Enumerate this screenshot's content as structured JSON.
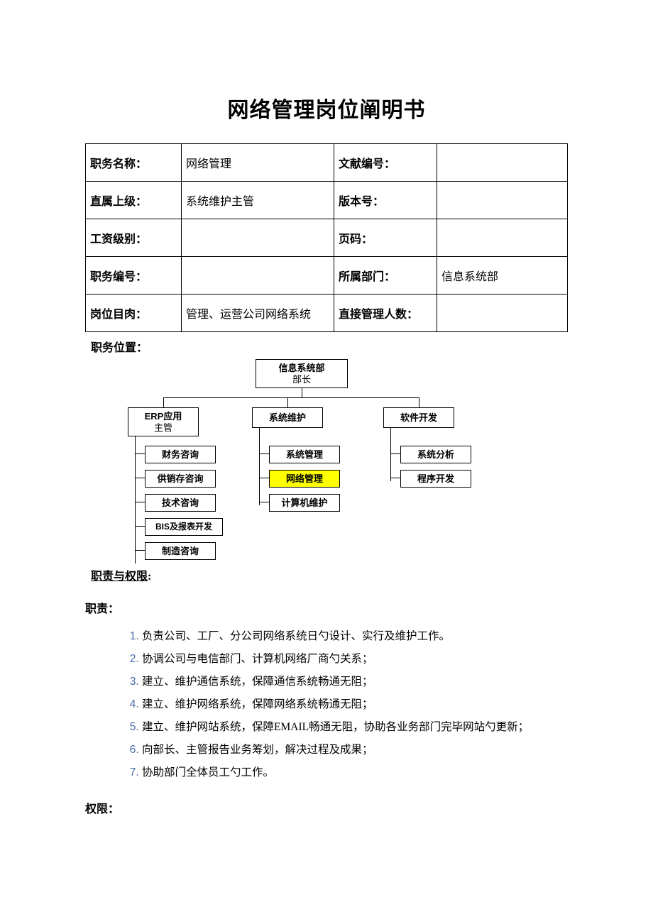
{
  "title": "网络管理岗位阐明书",
  "info": {
    "row1": {
      "l1": "职务名称：",
      "v1": "网络管理",
      "l2": "文献编号：",
      "v2": ""
    },
    "row2": {
      "l1": "直属上级：",
      "v1": "系统维护主管",
      "l2": "版本号：",
      "v2": ""
    },
    "row3": {
      "l1": "工资级别：",
      "v1": "",
      "l2": "页码：",
      "v2": ""
    },
    "row4": {
      "l1": "职务编号：",
      "v1": "",
      "l2": "所属部门：",
      "v2": "信息系统部"
    },
    "row5": {
      "l1": "岗位目肉：",
      "v1": "管理、运营公司网络系统",
      "l2": "直接管理人数：",
      "v2": ""
    }
  },
  "labels": {
    "position": "职务位置：",
    "rp": "职责与权限",
    "resp": "职责：",
    "auth": "权限："
  },
  "org": {
    "top": {
      "line1": "信息系统部",
      "line2": "部长"
    },
    "mids": {
      "erp_line1": "ERP应用",
      "erp_line2": "主管",
      "sys": "系统维护",
      "dev": "软件开发"
    },
    "col1": [
      "财务咨询",
      "供销存咨询",
      "技术咨询",
      "BIS及报表开发",
      "制造咨询"
    ],
    "col2": [
      "系统管理",
      "网络管理",
      "计算机维护"
    ],
    "col3": [
      "系统分析",
      "程序开发"
    ]
  },
  "resp_list": [
    "负责公司、工厂、分公司网络系统日勺设计、实行及维护工作。",
    "协调公司与电信部门、计算机网络厂商勺关系；",
    "建立、维护通信系统，保障通信系统畅通无阻；",
    "建立、维护网络系统，保障网络系统畅通无阻；",
    "建立、维护网站系统，保障EMAIL畅通无阻，协助各业务部门完毕网站勺更新；",
    "向部长、主管报告业务筹划，解决过程及成果；",
    "协助部门全体员工勺工作。"
  ]
}
